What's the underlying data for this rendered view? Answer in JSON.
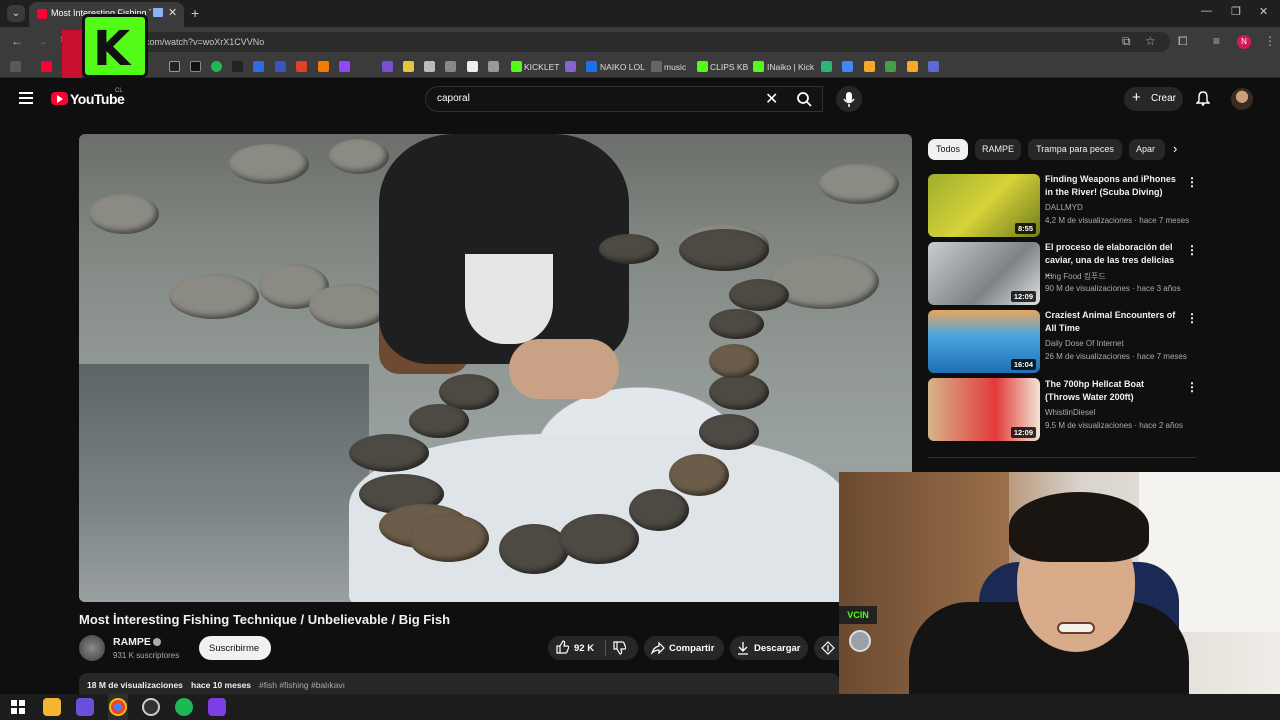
{
  "browser": {
    "tab_title": "Most Interesting Fishing Tec",
    "url": "com/watch?v=woXrX1CVVNo",
    "profile_initial": "N",
    "bookmarks": [
      "KICKLET",
      "NAIKO LOL",
      "music",
      "CLIPS KB",
      "INaiko | Kick"
    ]
  },
  "header": {
    "logo_text": "YouTube",
    "country": "CL",
    "search_query": "caporal",
    "create_label": "Crear"
  },
  "video": {
    "title": "Most İnteresting Fishing Technique / Unbelievable / Big Fish",
    "channel": "RAMPE",
    "subscribers": "931 K suscriptores",
    "subscribe_label": "Suscribirme",
    "likes": "92 K",
    "share_label": "Compartir",
    "download_label": "Descargar",
    "views": "18 M de visualizaciones",
    "ago": "hace 10 meses",
    "tags": "#fish #fishing #balıkavı"
  },
  "chips": [
    "Todos",
    "RAMPE",
    "Trampa para peces",
    "Apar"
  ],
  "recommendations": [
    {
      "title": "Finding Weapons and iPhones in the River! (Scuba Diving)",
      "channel": "DALLMYD",
      "meta": "4,2 M de visualizaciones · hace 7 meses",
      "duration": "8:55",
      "color": "#b8b92a"
    },
    {
      "title": "El proceso de elaboración del caviar, una de las tres delicias ...",
      "channel": "King Food 킹푸드",
      "meta": "90 M de visualizaciones · hace 3 años",
      "duration": "12:09",
      "color": "#9aa0a4"
    },
    {
      "title": "Craziest Animal Encounters of All Time",
      "channel": "Daily Dose Of Internet",
      "meta": "26 M de visualizaciones · hace 7 meses",
      "duration": "16:04",
      "color": "#3c8fd0"
    },
    {
      "title": "The 700hp Hellcat Boat (Throws Water 200ft)",
      "channel": "WhistlinDiesel",
      "meta": "9,5 M de visualizaciones · hace 2 años",
      "duration": "12:09",
      "color": "#c4a27a"
    }
  ],
  "webcam": {
    "badge": "VCIN"
  }
}
